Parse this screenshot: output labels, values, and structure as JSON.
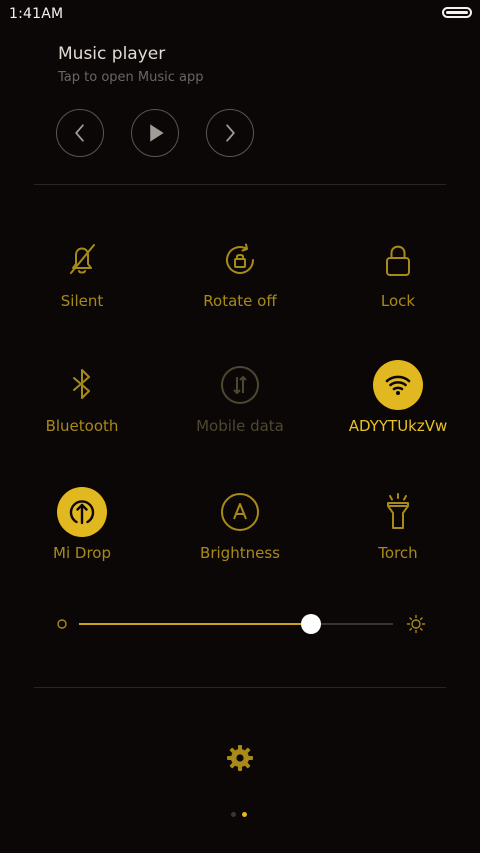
{
  "status_bar": {
    "time": "1:41AM"
  },
  "music": {
    "title": "Music player",
    "subtitle": "Tap to open Music app"
  },
  "toggles": [
    {
      "label": "Silent",
      "icon": "bell-off-icon",
      "state": "inactive"
    },
    {
      "label": "Rotate off",
      "icon": "rotation-lock-icon",
      "state": "inactive"
    },
    {
      "label": "Lock",
      "icon": "lock-icon",
      "state": "inactive"
    },
    {
      "label": "Bluetooth",
      "icon": "bluetooth-icon",
      "state": "inactive"
    },
    {
      "label": "Mobile data",
      "icon": "mobile-data-icon",
      "state": "disabled"
    },
    {
      "label": "ADYYTUkzVw",
      "icon": "wifi-icon",
      "state": "active"
    },
    {
      "label": "Mi Drop",
      "icon": "mi-drop-icon",
      "state": "active"
    },
    {
      "label": "Brightness",
      "icon": "auto-brightness-icon",
      "state": "inactive"
    },
    {
      "label": "Torch",
      "icon": "torch-icon",
      "state": "inactive"
    }
  ],
  "brightness": {
    "level": 0.74
  },
  "pager": {
    "pages": 2,
    "current": 2
  },
  "colors": {
    "background": "#0b0706",
    "accent": "#e1b81f",
    "accent_dim": "#a88a19",
    "disabled": "#4e4732"
  }
}
